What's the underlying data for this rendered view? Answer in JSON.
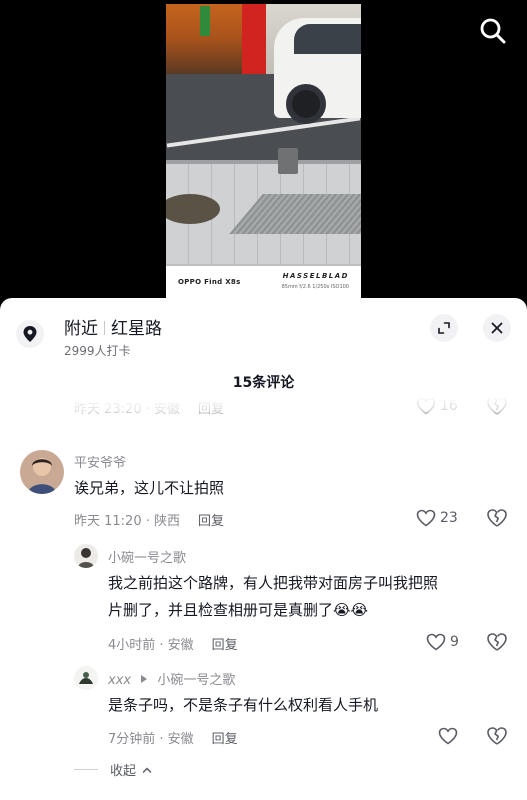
{
  "video": {
    "watermark_model": "OPPO Find X8s",
    "watermark_brand": "HASSELBLAD",
    "watermark_specs": "85mm f/2.6 1/250s ISO100"
  },
  "icons": {
    "search": "search-icon",
    "pin": "location-pin-icon",
    "expand": "expand-icon",
    "close": "close-icon",
    "like": "heart-icon",
    "dislike": "broken-heart-icon",
    "reply_arrow": "triangle-right-icon",
    "collapse": "chevron-up-icon"
  },
  "colors": {
    "text_primary": "#161823",
    "text_secondary": "#8a8b91",
    "sheet_bg": "#ffffff",
    "page_bg": "#000000"
  },
  "location": {
    "area": "附近",
    "place": "红星路",
    "checkins": "2999人打卡"
  },
  "comments_header": "15条评论",
  "previous_comment": {
    "time_location": "昨天 23:20 · 安徽",
    "reply_label": "回复",
    "likes": "16"
  },
  "comment": {
    "username": "平安爷爷",
    "text": "诶兄弟，这儿不让拍照",
    "time_location": "昨天 11:20 · 陕西",
    "reply_label": "回复",
    "likes": "23"
  },
  "replies": [
    {
      "username": "小碗一号之歌",
      "text_line1": "我之前拍这个路牌，有人把我带对面房子叫我把照",
      "text_line2": "片删了，并且检查相册可是真删了",
      "emoji": "😭😭",
      "time_location": "4小时前 · 安徽",
      "reply_label": "回复",
      "likes": "9"
    },
    {
      "username": "xxx",
      "reply_to": "小碗一号之歌",
      "text": "是条子吗，不是条子有什么权利看人手机",
      "time_location": "7分钟前 · 安徽",
      "reply_label": "回复"
    }
  ],
  "collapse_label": "收起"
}
